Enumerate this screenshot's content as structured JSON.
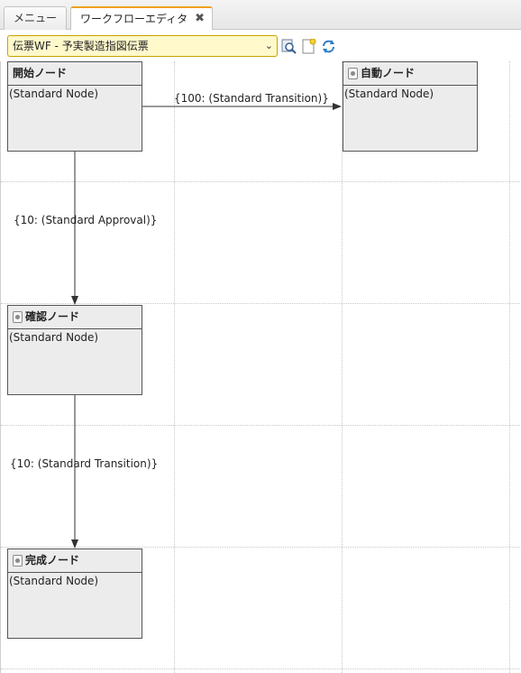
{
  "tabs": [
    {
      "label": "メニュー"
    },
    {
      "label": "ワークフローエディタ",
      "close": "✖"
    }
  ],
  "toolbar": {
    "workflow_select": "伝票WF - 予実製造指図伝票",
    "icons": [
      "search-zoom-icon",
      "new-document-icon",
      "refresh-icon"
    ]
  },
  "nodes": {
    "start": {
      "title": "開始ノード",
      "type": "(Standard Node)"
    },
    "auto": {
      "title": "自動ノード",
      "type": "(Standard Node)"
    },
    "confirm": {
      "title": "確認ノード",
      "type": "(Standard Node)"
    },
    "complete": {
      "title": "完成ノード",
      "type": "(Standard Node)"
    }
  },
  "edges": {
    "start_to_auto": "{100: (Standard Transition)}",
    "start_to_confirm": "{10: (Standard Approval)}",
    "confirm_to_complete": "{10: (Standard Transition)}"
  },
  "colors": {
    "active_tab_accent": "#f0a020",
    "select_background": "#fff9cc",
    "node_fill": "#ececec"
  }
}
